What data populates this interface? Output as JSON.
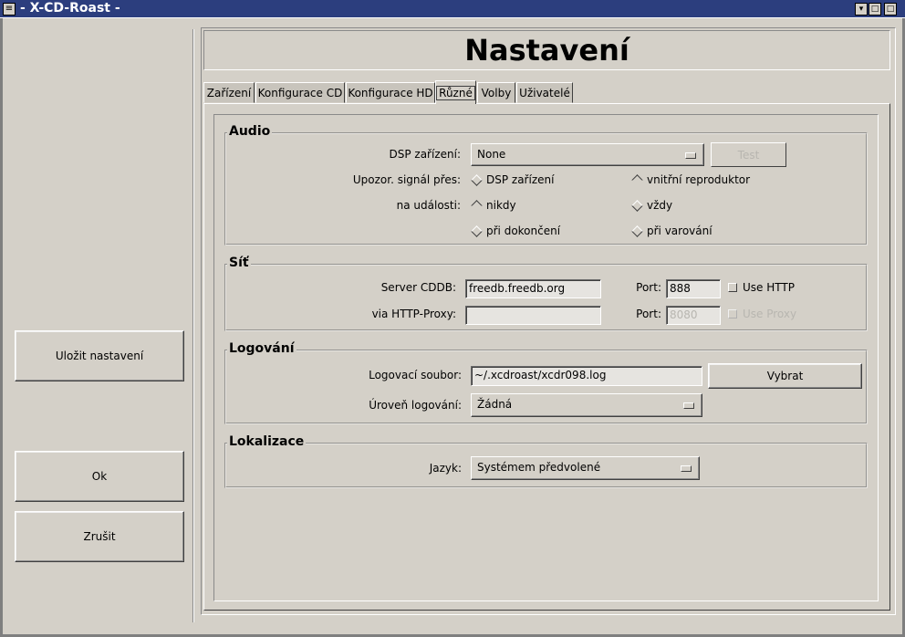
{
  "window": {
    "title": "- X-CD-Roast -",
    "menu_icon": "window-menu-icon",
    "controls": [
      "minimize-icon",
      "maximize-icon",
      "close-icon"
    ]
  },
  "sidebar": {
    "save_label": "Uložit nastavení",
    "ok_label": "Ok",
    "cancel_label": "Zrušit"
  },
  "header": {
    "title": "Nastavení"
  },
  "tabs": [
    {
      "label": "Zařízení",
      "active": false
    },
    {
      "label": "Konfigurace CD",
      "active": false
    },
    {
      "label": "Konfigurace HD",
      "active": false
    },
    {
      "label": "Různé",
      "active": true
    },
    {
      "label": "Volby",
      "active": false
    },
    {
      "label": "Uživatelé",
      "active": false
    }
  ],
  "audio": {
    "title": "Audio",
    "dsp_label": "DSP zařízení:",
    "dsp_value": "None",
    "test_label": "Test",
    "signal_label": "Upozor. signál přes:",
    "signal_options": [
      "DSP zařízení",
      "vnitřní reproduktor"
    ],
    "events_label": "na události:",
    "event_options": [
      "nikdy",
      "vždy",
      "při dokončení",
      "při varování"
    ]
  },
  "network": {
    "title": "Síť",
    "server_label": "Server CDDB:",
    "server_value": "freedb.freedb.org",
    "port_label": "Port:",
    "port_value": "888",
    "use_http_label": "Use HTTP",
    "proxy_label": "via HTTP-Proxy:",
    "proxy_value": "",
    "proxy_port_label": "Port:",
    "proxy_port_value": "8080",
    "use_proxy_label": "Use Proxy"
  },
  "logging": {
    "title": "Logování",
    "file_label": "Logovací soubor:",
    "file_value": "~/.xcdroast/xcdr098.log",
    "browse_label": "Vybrat",
    "level_label": "Úroveň logování:",
    "level_value": "Žádná"
  },
  "locale": {
    "title": "Lokalizace",
    "language_label": "Jazyk:",
    "language_value": "Systémem předvolené"
  }
}
